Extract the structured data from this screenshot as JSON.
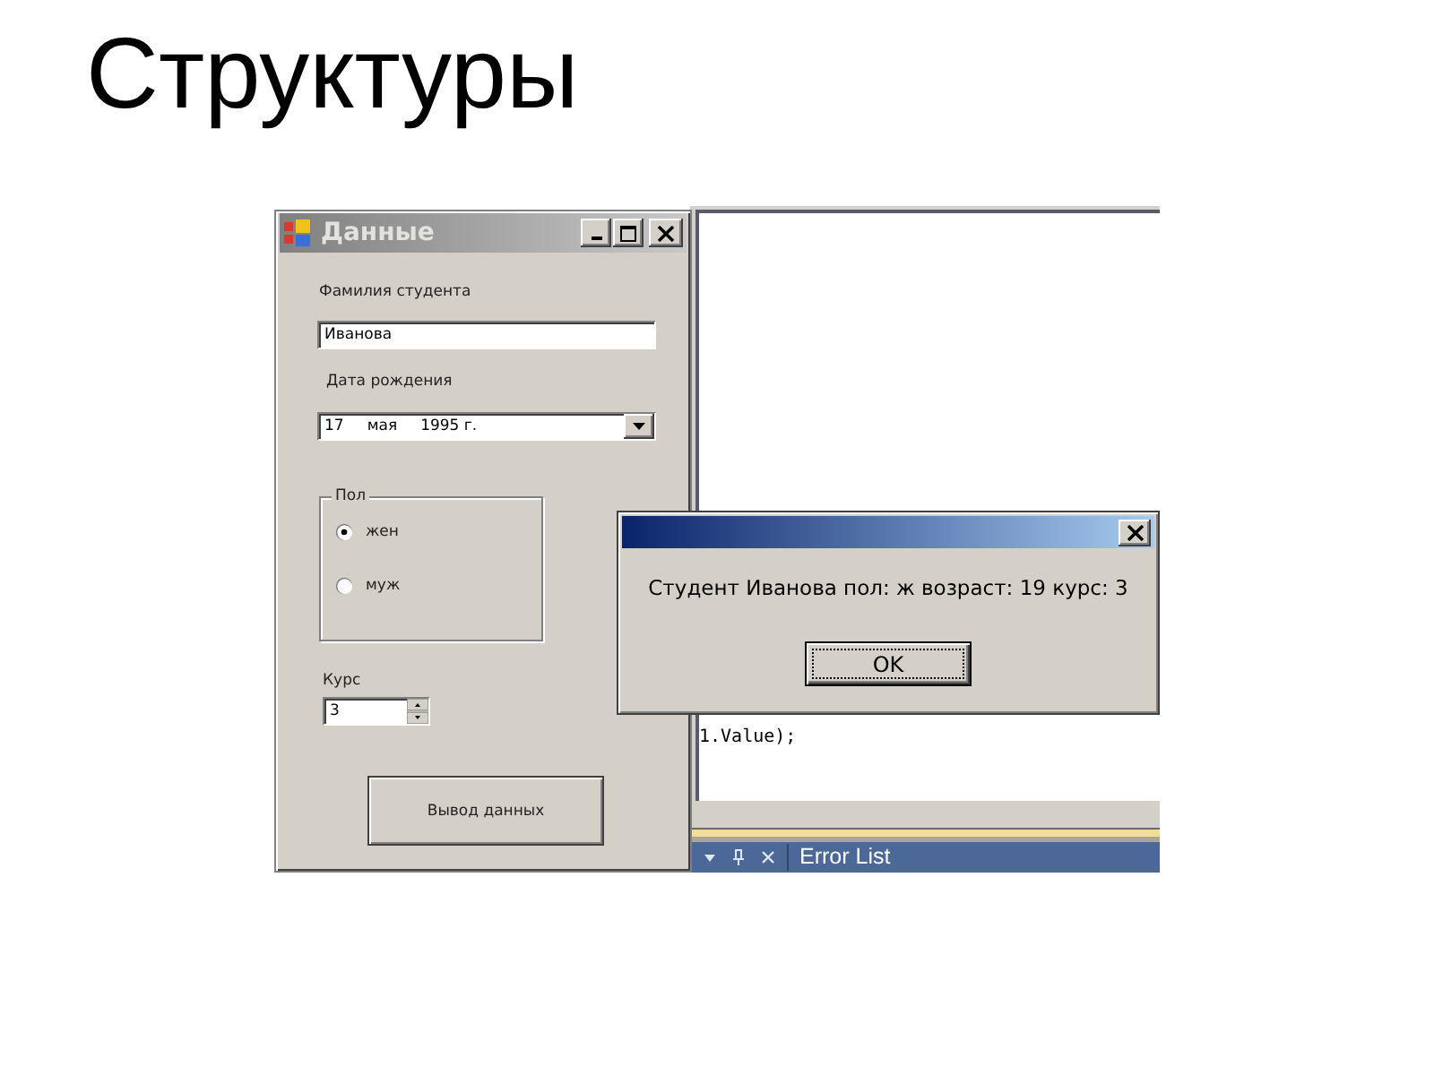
{
  "slide": {
    "title": "Структуры"
  },
  "ide": {
    "code_line": "1.Value);",
    "panel_tab": "Error List"
  },
  "form": {
    "title": "Данные",
    "active": false,
    "surname": {
      "label": "Фамилия студента",
      "value": "Иванова"
    },
    "birth_date": {
      "label": "Дата рождения",
      "parts": [
        "17",
        "мая",
        "1995 г."
      ]
    },
    "gender": {
      "label": "Пол",
      "options": [
        {
          "label": "жен",
          "selected": true
        },
        {
          "label": "муж",
          "selected": false
        }
      ]
    },
    "course": {
      "label": "Курс",
      "value": "3"
    },
    "submit_button": "Вывод данных"
  },
  "message_box": {
    "active": true,
    "text": "Студент Иванова пол: ж возраст: 19 курс: 3",
    "ok_button": {
      "label": "OK",
      "focused": true
    }
  }
}
